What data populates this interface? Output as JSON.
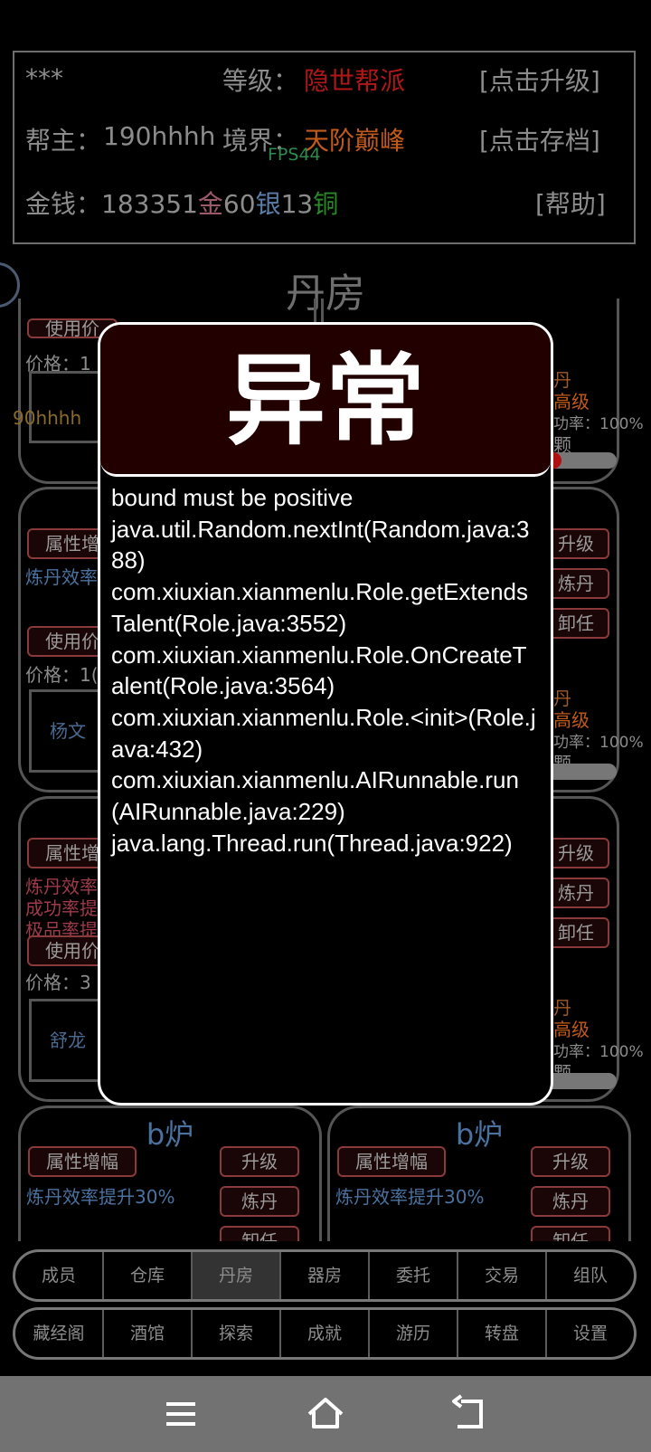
{
  "header": {
    "sect_name": "***",
    "level_label": "等级：",
    "level_value": "隐世帮派",
    "upgrade_link": "[点击升级]",
    "leader_label": "帮主：",
    "leader_name": "190hhhh",
    "realm_label": "境界：",
    "realm_value": "天阶巅峰",
    "save_link": "[点击存档]",
    "money_label": "金钱：",
    "gold_amount": "183351",
    "gold_unit": "金",
    "silver_amount": "60",
    "silver_unit": "银",
    "copper_amount": "13",
    "copper_unit": "铜",
    "help_link": "[帮助]",
    "fps": "FPS44"
  },
  "page_title": "丹房",
  "background_cards": {
    "use_label": "使用价",
    "price_label": "价格：",
    "attr_label": "属性增",
    "efficiency_label": "炼丹效率",
    "success_label": "成功率提",
    "quality_label": "极品率提",
    "upgrade": "升级",
    "refine": "炼丹",
    "dismiss": "卸任",
    "dan": "丹",
    "advanced": "高级",
    "rate_text": "功率：100%",
    "grain": "颗",
    "owner_fragment": "90hhhh",
    "npc_1": "杨文",
    "npc_2": "舒龙",
    "price_1": "1",
    "price_2": "1(",
    "price_3": "3"
  },
  "bottom_cards": [
    {
      "title": "b炉",
      "attr_button": "属性增幅",
      "effect": "炼丹效率提升30%",
      "upgrade": "升级",
      "refine": "炼丹",
      "dismiss": "卸任"
    },
    {
      "title": "b炉",
      "attr_button": "属性增幅",
      "effect": "炼丹效率提升30%",
      "upgrade": "升级",
      "refine": "炼丹",
      "dismiss": "卸任"
    }
  ],
  "dialog": {
    "title": "异常",
    "message": "bound must be positive\njava.util.Random.nextInt(Random.java:388)\ncom.xiuxian.xianmenlu.Role.getExtendsTalent(Role.java:3552)\ncom.xiuxian.xianmenlu.Role.OnCreateTalent(Role.java:3564)\ncom.xiuxian.xianmenlu.Role.<init>(Role.java:432)\ncom.xiuxian.xianmenlu.AIRunnable.run(AIRunnable.java:229)\njava.lang.Thread.run(Thread.java:922)"
  },
  "tabs_row1": [
    "成员",
    "仓库",
    "丹房",
    "器房",
    "委托",
    "交易",
    "组队"
  ],
  "tabs_row2": [
    "藏经阁",
    "酒馆",
    "探索",
    "成就",
    "游历",
    "转盘",
    "设置"
  ],
  "active_tab": "丹房",
  "progress": {
    "top_right_furnace": 0.25
  },
  "colors": {
    "danger": "#b01818",
    "accent_blue": "#4a72a0",
    "dialog_header_bg": "#220000"
  },
  "nav_icons": [
    "menu-icon",
    "home-icon",
    "back-icon"
  ]
}
